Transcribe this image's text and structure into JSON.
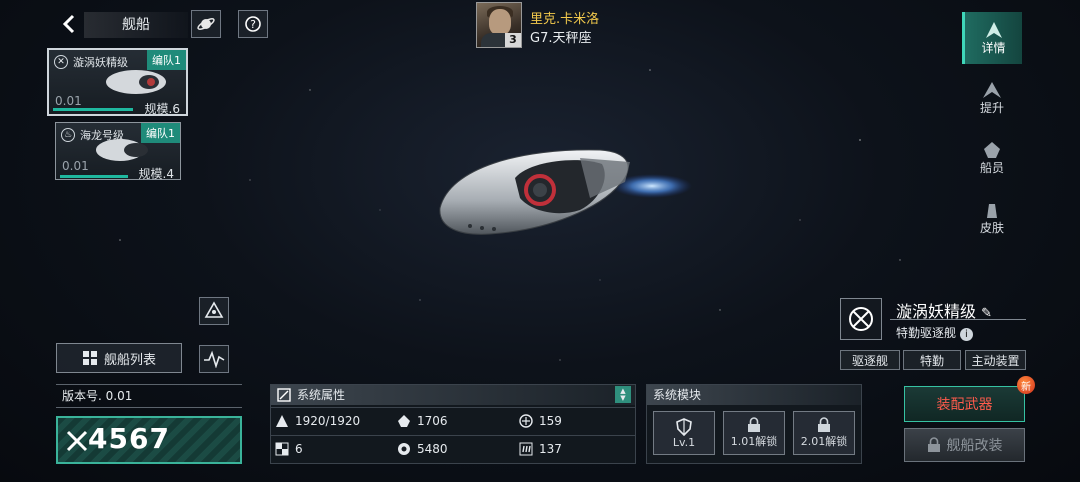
{
  "header": {
    "title": "舰船",
    "icons": {
      "back": "chevron-left-icon",
      "planet": "planet-icon",
      "help": "question-icon"
    }
  },
  "commander": {
    "name": "里克.卡米洛",
    "rank": "G7.天秤座",
    "level": "3"
  },
  "ship_cards": [
    {
      "name": "漩涡妖精级",
      "fleet": "编队1",
      "value": "0.01",
      "size": "规模.6",
      "active": true
    },
    {
      "name": "海龙号级",
      "fleet": "编队1",
      "value": "0.01",
      "size": "规模.4",
      "active": false
    }
  ],
  "right_nav": [
    {
      "label": "详情",
      "icon": "details-icon",
      "active": true
    },
    {
      "label": "提升",
      "icon": "upgrade-icon",
      "active": false
    },
    {
      "label": "船员",
      "icon": "crew-icon",
      "active": false
    },
    {
      "label": "皮肤",
      "icon": "skin-icon",
      "active": false
    }
  ],
  "ship_info": {
    "name": "漩涡妖精级",
    "type": "特勤驱逐舰",
    "tags": [
      "驱逐舰",
      "特勤",
      "主动装置"
    ]
  },
  "ship_list_button": "舰船列表",
  "version": {
    "label": "版本号. 0.01",
    "power": "4567"
  },
  "system_attributes": {
    "title": "系统属性",
    "stats": [
      {
        "icon": "hull-icon",
        "value": "1920/1920"
      },
      {
        "icon": "armor-icon",
        "value": "1706"
      },
      {
        "icon": "shield-icon",
        "value": "159"
      },
      {
        "icon": "checker-icon",
        "value": "6"
      },
      {
        "icon": "energy-icon",
        "value": "5480"
      },
      {
        "icon": "speed-icon",
        "value": "137"
      }
    ]
  },
  "system_modules": {
    "title": "系统模块",
    "slots": [
      {
        "label": "Lv.1",
        "icon": "shield-module-icon"
      },
      {
        "label": "1.01解锁",
        "icon": "lock-icon"
      },
      {
        "label": "2.01解锁",
        "icon": "lock-icon"
      }
    ]
  },
  "actions": {
    "equip_weapon": "装配武器",
    "new_badge": "新",
    "ship_modify": "舰船改装"
  }
}
